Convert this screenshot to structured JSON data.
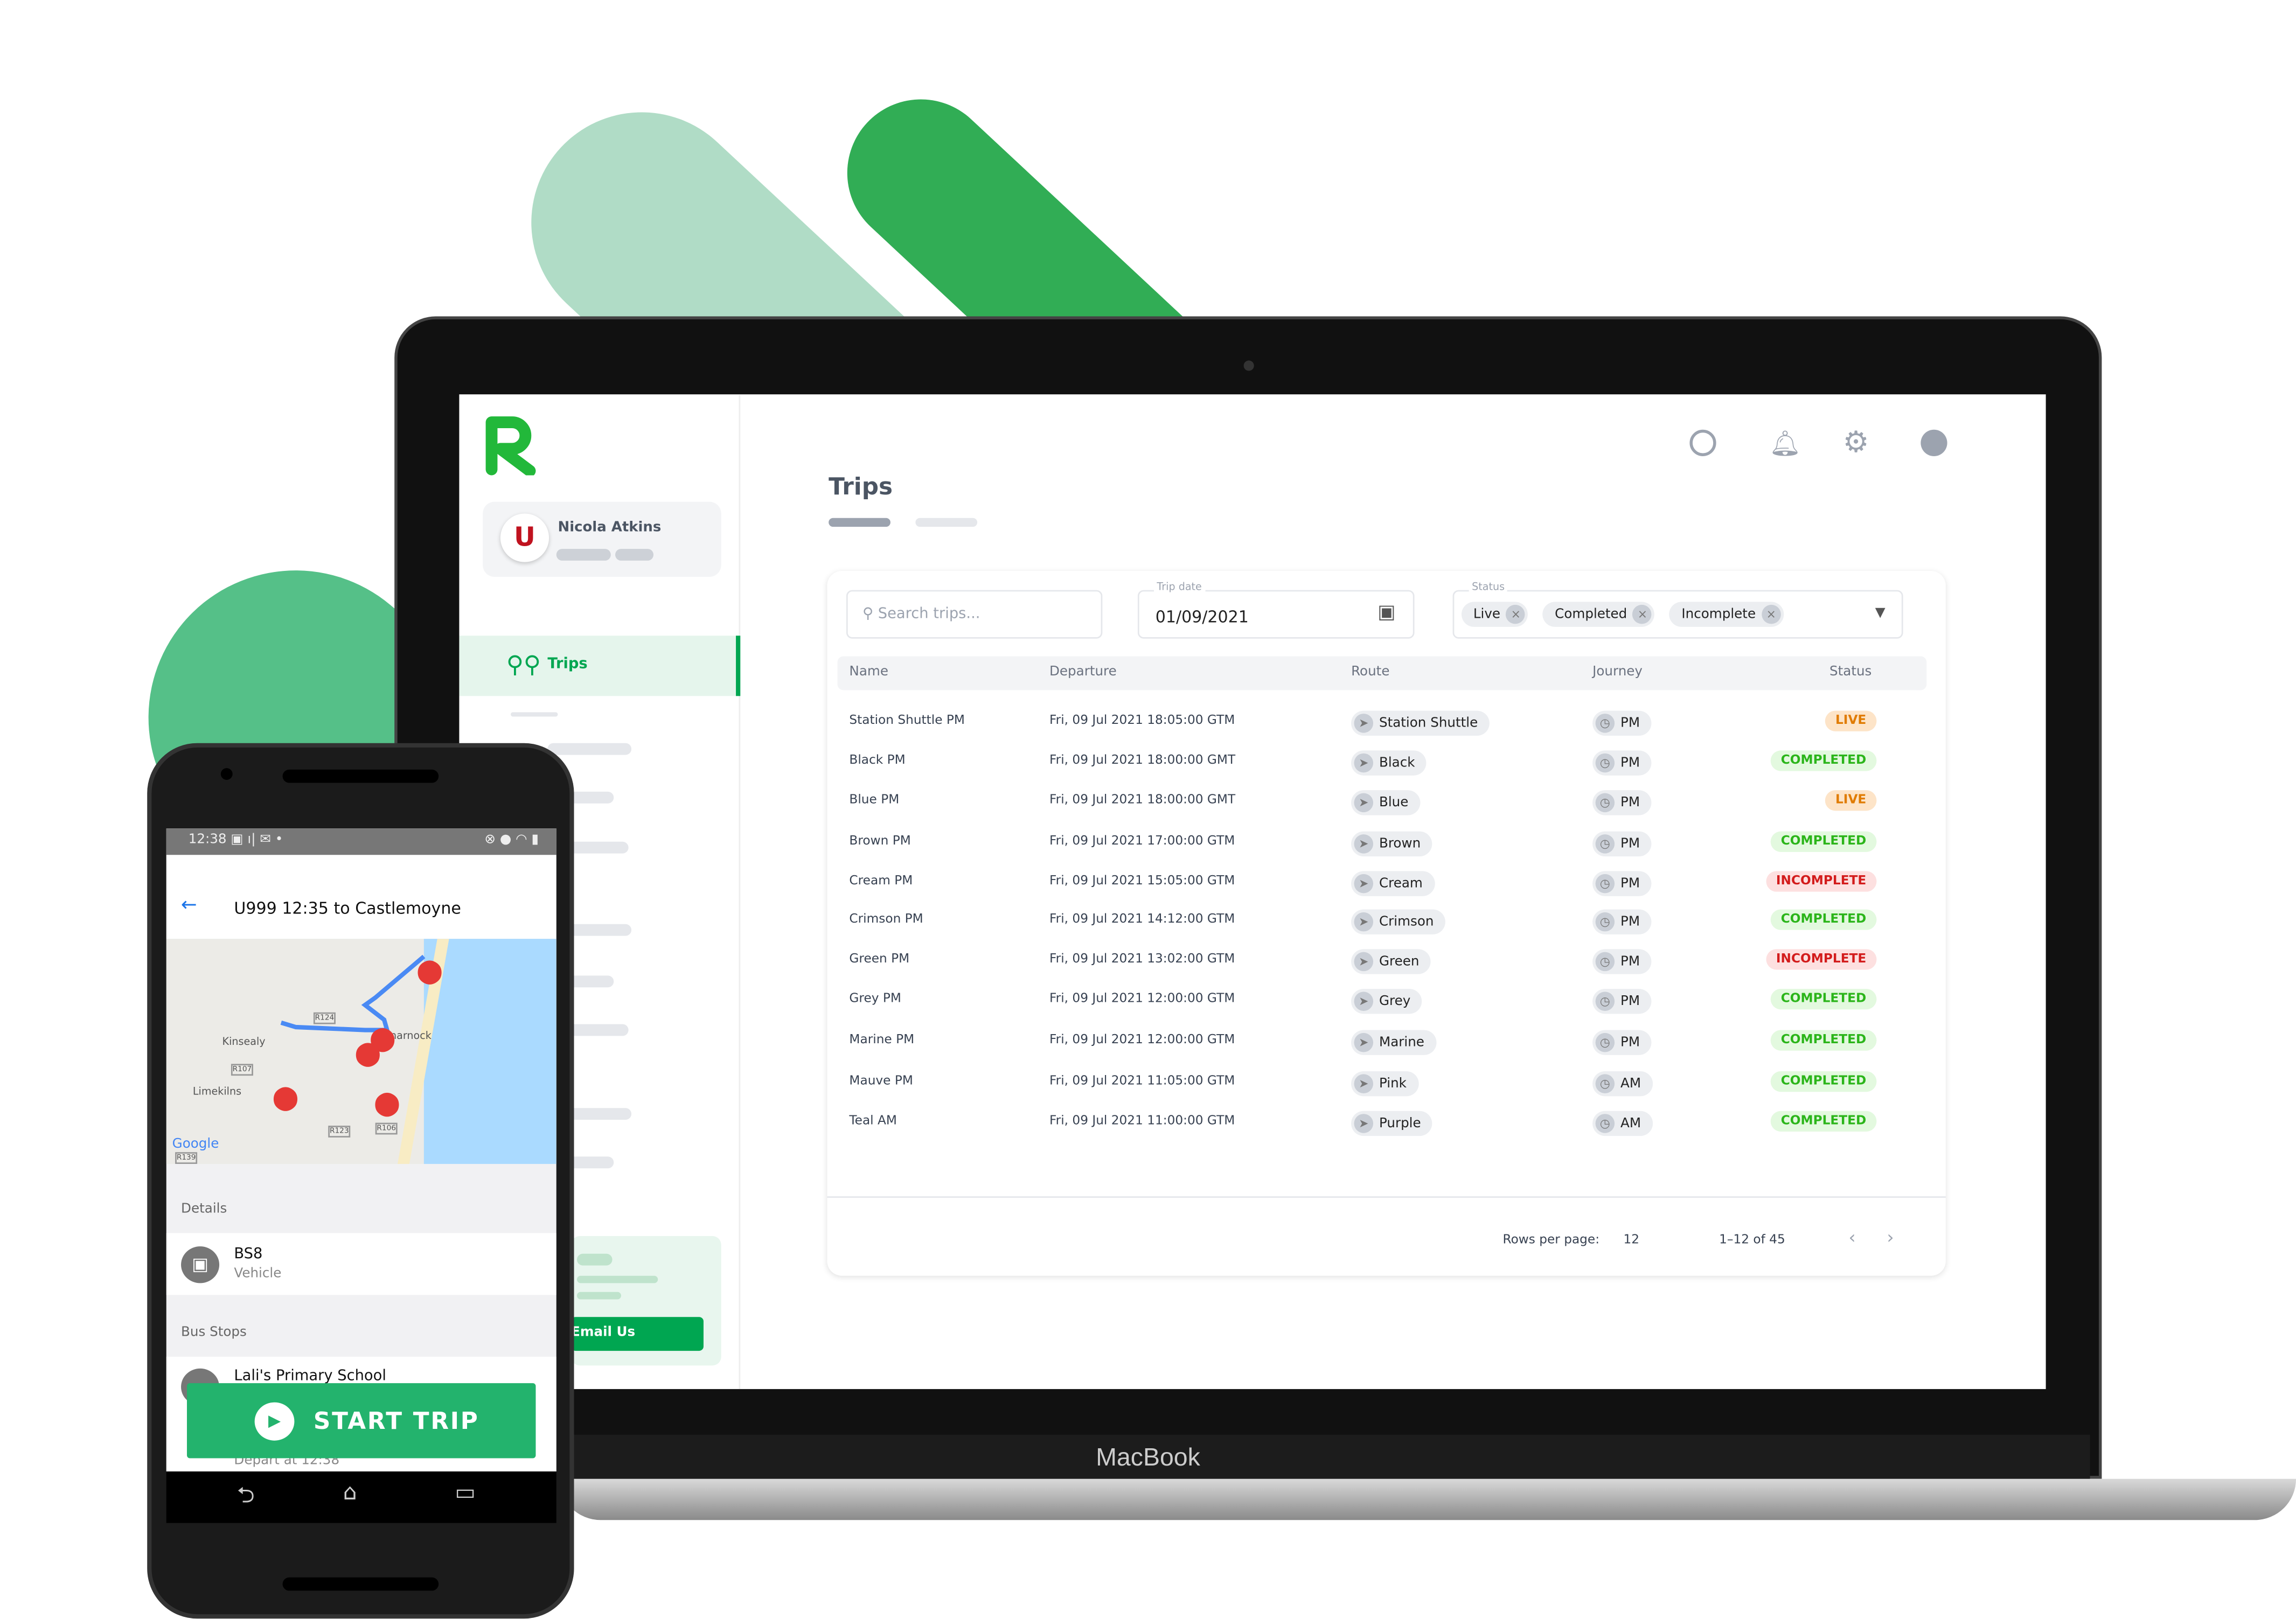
{
  "colors": {
    "brand": "#00a651",
    "live_bg": "#fde4c8",
    "live_fg": "#e07b00",
    "completed_bg": "#e3f9df",
    "completed_fg": "#2bb51a",
    "incomplete_bg": "#fde0e0",
    "incomplete_fg": "#d31c1c"
  },
  "laptop": {
    "brand_label": "MacBook"
  },
  "sidebar": {
    "user_name": "Nicola Atkins",
    "nav": [
      {
        "label": "Trips",
        "icon": "route-icon",
        "active": true
      }
    ],
    "email_button": "Email Us"
  },
  "header": {
    "icons": [
      "globe-icon",
      "bell-icon",
      "gear-icon",
      "user-icon"
    ]
  },
  "page": {
    "title": "Trips"
  },
  "filters": {
    "search_placeholder": "Search trips...",
    "date_label": "Trip date",
    "date_value": "01/09/2021",
    "status_label": "Status",
    "status_chips": [
      "Live",
      "Completed",
      "Incomplete"
    ]
  },
  "table": {
    "columns": [
      "Name",
      "Departure",
      "Route",
      "Journey",
      "Status"
    ],
    "rows": [
      {
        "name": "Station Shuttle PM",
        "departure": "Fri, 09 Jul 2021 18:05:00 GTM",
        "route": "Station Shuttle",
        "journey": "PM",
        "status": "LIVE"
      },
      {
        "name": "Black PM",
        "departure": "Fri, 09 Jul 2021 18:00:00 GMT",
        "route": "Black",
        "journey": "PM",
        "status": "COMPLETED"
      },
      {
        "name": "Blue PM",
        "departure": "Fri, 09 Jul 2021 18:00:00 GMT",
        "route": "Blue",
        "journey": "PM",
        "status": "LIVE"
      },
      {
        "name": "Brown PM",
        "departure": "Fri, 09 Jul 2021 17:00:00 GTM",
        "route": "Brown",
        "journey": "PM",
        "status": "COMPLETED"
      },
      {
        "name": "Cream PM",
        "departure": "Fri, 09 Jul 2021 15:05:00 GTM",
        "route": "Cream",
        "journey": "PM",
        "status": "INCOMPLETE"
      },
      {
        "name": "Crimson PM",
        "departure": "Fri, 09 Jul 2021 14:12:00 GTM",
        "route": "Crimson",
        "journey": "PM",
        "status": "COMPLETED"
      },
      {
        "name": "Green PM",
        "departure": "Fri, 09 Jul 2021 13:02:00 GTM",
        "route": "Green",
        "journey": "PM",
        "status": "INCOMPLETE"
      },
      {
        "name": "Grey PM",
        "departure": "Fri, 09 Jul 2021 12:00:00 GTM",
        "route": "Grey",
        "journey": "PM",
        "status": "COMPLETED"
      },
      {
        "name": "Marine PM",
        "departure": "Fri, 09 Jul 2021 12:00:00 GTM",
        "route": "Marine",
        "journey": "PM",
        "status": "COMPLETED"
      },
      {
        "name": "Mauve PM",
        "departure": "Fri, 09 Jul 2021 11:05:00 GTM",
        "route": "Pink",
        "journey": "AM",
        "status": "COMPLETED"
      },
      {
        "name": "Teal AM",
        "departure": "Fri, 09 Jul 2021 11:00:00 GTM",
        "route": "Purple",
        "journey": "AM",
        "status": "COMPLETED"
      }
    ]
  },
  "pagination": {
    "rows_per_page_label": "Rows per page:",
    "rows_per_page": "12",
    "range": "1–12 of 45"
  },
  "phone": {
    "time": "12:38",
    "title": "U999 12:35 to Castlemoyne",
    "map_labels": [
      "Kinsealy",
      "Limekilns",
      "narnock",
      "R124",
      "R107",
      "R123",
      "R106",
      "R139",
      "Google"
    ],
    "details_header": "Details",
    "vehicle": {
      "name": "BS8",
      "sub": "Vehicle"
    },
    "stops_header": "Bus Stops",
    "stop": {
      "name": "Lali's Primary School",
      "sub": "Depart at 12:38"
    },
    "start_button": "START TRIP"
  }
}
